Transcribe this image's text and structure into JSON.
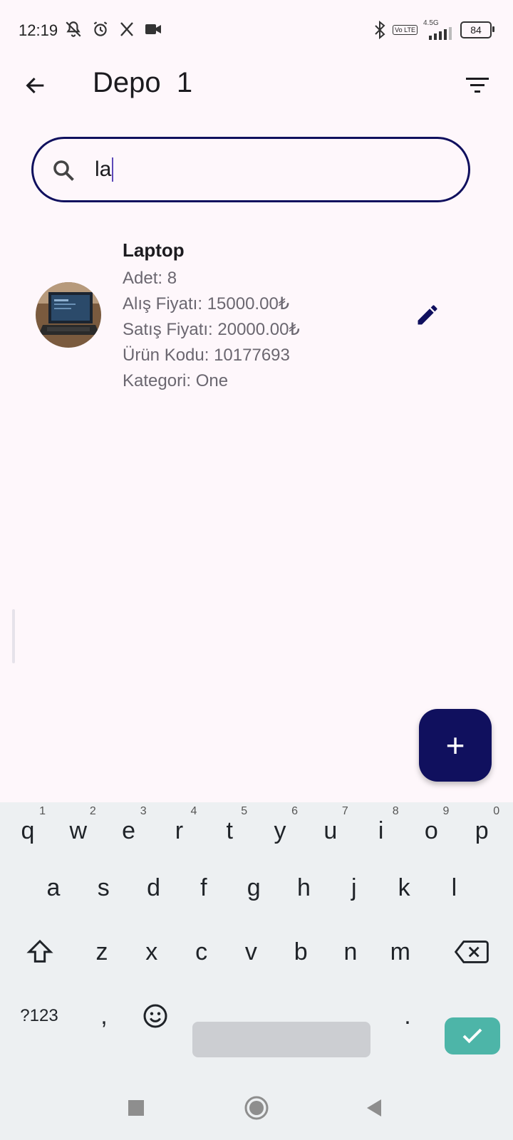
{
  "status_bar": {
    "time": "12:19",
    "network_type": "4.5G",
    "volte": "Vo LTE",
    "battery": "84",
    "icons_left": [
      "mute-bell-icon",
      "alarm-icon",
      "x-app-icon",
      "video-icon"
    ],
    "icons_right": [
      "bluetooth-icon",
      "volte-icon",
      "signal-icon",
      "battery-icon"
    ]
  },
  "appbar": {
    "title": "Depo  1",
    "back_icon": "arrow-back-icon",
    "filter_icon": "filter-icon"
  },
  "search": {
    "value": "la",
    "icon": "search-icon"
  },
  "products": [
    {
      "name": "Laptop",
      "quantity": "Adet: 8",
      "purchase_price": "Alış Fiyatı: 15000.00₺",
      "sale_price": "Satış Fiyatı: 20000.00₺",
      "code": "Ürün Kodu: 10177693",
      "category": "Kategori: One"
    }
  ],
  "fab": {
    "label": "+"
  },
  "keyboard": {
    "row1": [
      {
        "k": "q",
        "n": "1"
      },
      {
        "k": "w",
        "n": "2"
      },
      {
        "k": "e",
        "n": "3"
      },
      {
        "k": "r",
        "n": "4"
      },
      {
        "k": "t",
        "n": "5"
      },
      {
        "k": "y",
        "n": "6"
      },
      {
        "k": "u",
        "n": "7"
      },
      {
        "k": "i",
        "n": "8"
      },
      {
        "k": "o",
        "n": "9"
      },
      {
        "k": "p",
        "n": "0"
      }
    ],
    "row2": [
      "a",
      "s",
      "d",
      "f",
      "g",
      "h",
      "j",
      "k",
      "l"
    ],
    "row3": [
      "z",
      "x",
      "c",
      "v",
      "b",
      "n",
      "m"
    ],
    "symbols_label": "?123",
    "comma": ",",
    "period": "."
  },
  "colors": {
    "primary": "#10105e",
    "background": "#fef7fb",
    "accent_enter": "#4db5a8"
  }
}
